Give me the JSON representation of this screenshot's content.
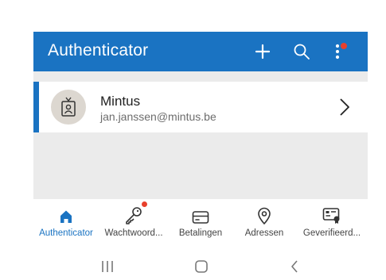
{
  "appbar": {
    "title": "Authenticator",
    "add_icon": "plus-icon",
    "search_icon": "search-icon",
    "more_icon": "more-vertical-icon",
    "has_notification": true
  },
  "account": {
    "name": "Mintus",
    "email": "jan.janssen@mintus.be",
    "avatar_icon": "id-badge-icon",
    "chevron_icon": "chevron-right-icon"
  },
  "bottom_nav": {
    "items": [
      {
        "label": "Authenticator",
        "icon": "home-icon",
        "active": true
      },
      {
        "label": "Wachtwoord...",
        "icon": "key-icon",
        "badge": true
      },
      {
        "label": "Betalingen",
        "icon": "credit-card-icon"
      },
      {
        "label": "Adressen",
        "icon": "location-pin-icon"
      },
      {
        "label": "Geverifieerd...",
        "icon": "verified-id-icon"
      }
    ]
  },
  "system_nav": {
    "recents_icon": "recents-icon",
    "home_icon": "home-button-icon",
    "back_icon": "back-icon"
  },
  "colors": {
    "primary": "#1a73c2",
    "notification": "#e8402c",
    "content_bg": "#ebebeb"
  }
}
